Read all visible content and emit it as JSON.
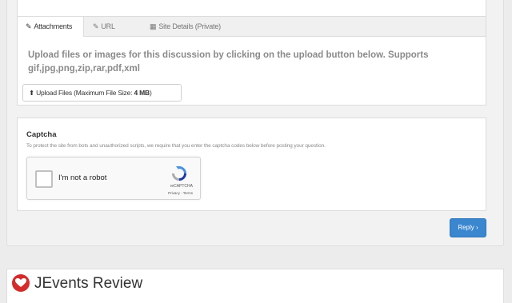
{
  "tabs": [
    {
      "label": "Attachments",
      "icon": "paperclip-icon",
      "active": true
    },
    {
      "label": "URL",
      "icon": "link-icon",
      "active": false
    },
    {
      "label": "Site Details (Private)",
      "icon": "table-icon",
      "active": false
    }
  ],
  "attachments": {
    "instructions": "Upload files or images for this discussion by clicking on the upload button below. Supports gif,jpg,png,zip,rar,pdf,xml",
    "upload_button_prefix": "Upload Files (Maximum File Size: ",
    "upload_button_size": "4 MB",
    "upload_button_suffix": ")"
  },
  "captcha": {
    "title": "Captcha",
    "description": "To protect the site from bots and unauthorized scripts, we require that you enter the captcha codes below before posting your question.",
    "checkbox_label": "I'm not a robot",
    "brand": "reCAPTCHA",
    "links": "Privacy - Terms"
  },
  "reply": {
    "label": "Reply",
    "arrow": "›"
  },
  "review": {
    "title": "JEvents Review"
  },
  "colors": {
    "reply_button": "#3a87cf",
    "review_icon": "#d42b2b"
  }
}
